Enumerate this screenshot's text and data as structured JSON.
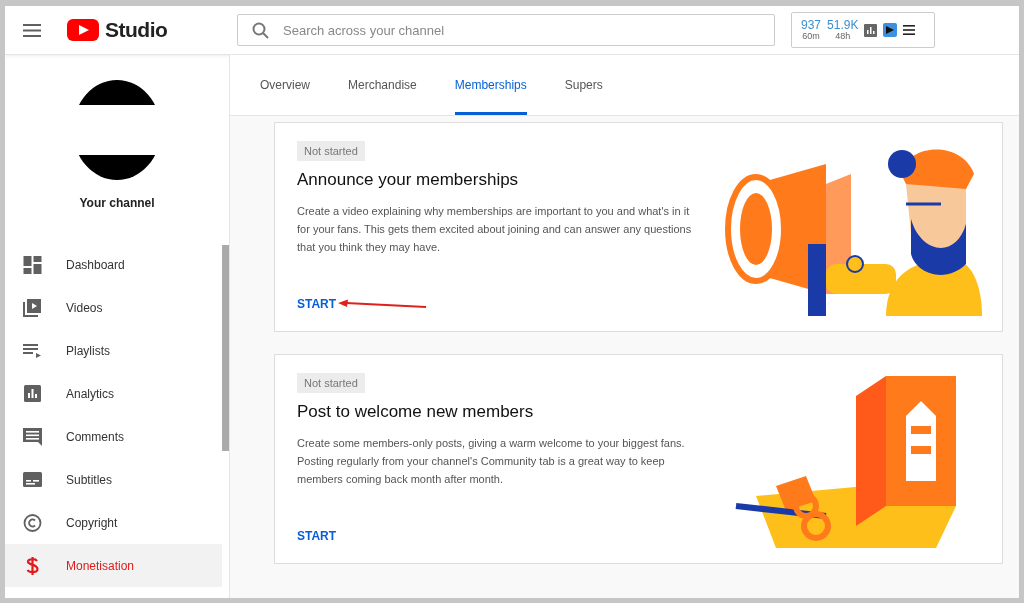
{
  "header": {
    "logo": "Studio",
    "search": {
      "placeholder": "Search across your channel"
    },
    "stats": [
      {
        "value": "937",
        "period": "60m"
      },
      {
        "value": "51.9K",
        "period": "48h"
      }
    ]
  },
  "sidebar": {
    "channel_label": "Your channel",
    "items": [
      {
        "label": "Dashboard",
        "kind": "dashboard",
        "selected": false
      },
      {
        "label": "Videos",
        "kind": "videos",
        "selected": false
      },
      {
        "label": "Playlists",
        "kind": "playlists",
        "selected": false
      },
      {
        "label": "Analytics",
        "kind": "analytics",
        "selected": false
      },
      {
        "label": "Comments",
        "kind": "comments",
        "selected": false
      },
      {
        "label": "Subtitles",
        "kind": "subtitles",
        "selected": false
      },
      {
        "label": "Copyright",
        "kind": "copyright",
        "selected": false
      },
      {
        "label": "Monetisation",
        "kind": "monetisation",
        "selected": true
      }
    ]
  },
  "tabs": [
    {
      "label": "Overview",
      "selected": false
    },
    {
      "label": "Merchandise",
      "selected": false
    },
    {
      "label": "Memberships",
      "selected": true
    },
    {
      "label": "Supers",
      "selected": false
    }
  ],
  "cards": [
    {
      "status": "Not started",
      "title": "Announce your memberships",
      "description": "Create a video explaining why memberships are important to you and what's in it for your fans. This gets them excited about joining and can answer any questions that you think they may have.",
      "action": "START",
      "kind": "megaphone",
      "annotated": true
    },
    {
      "status": "Not started",
      "title": "Post to welcome new members",
      "description": "Create some members-only posts, giving a warm welcome to your biggest fans. Posting regularly from your channel's Community tab is a great way to keep members coming back month after month.",
      "action": "START",
      "kind": "card",
      "annotated": false
    }
  ]
}
